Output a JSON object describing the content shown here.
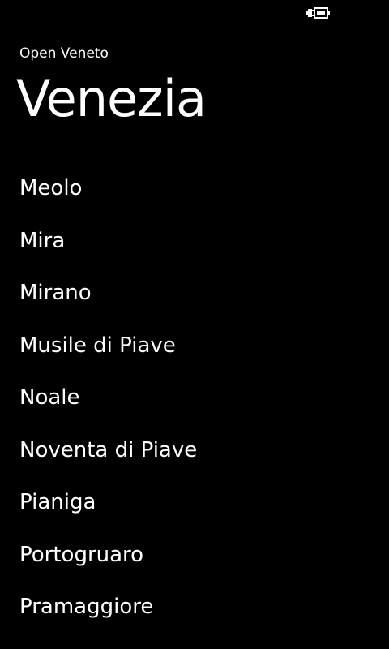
{
  "status_bar": {
    "battery_icon": "battery-charging-icon"
  },
  "app": {
    "title": "Open Veneto"
  },
  "page": {
    "title": "Venezia"
  },
  "list": {
    "items": [
      {
        "label": "Meolo"
      },
      {
        "label": "Mira"
      },
      {
        "label": "Mirano"
      },
      {
        "label": "Musile di Piave"
      },
      {
        "label": "Noale"
      },
      {
        "label": "Noventa di Piave"
      },
      {
        "label": "Pianiga"
      },
      {
        "label": "Portogruaro"
      },
      {
        "label": "Pramaggiore"
      }
    ]
  },
  "colors": {
    "background": "#000000",
    "foreground": "#ffffff"
  }
}
